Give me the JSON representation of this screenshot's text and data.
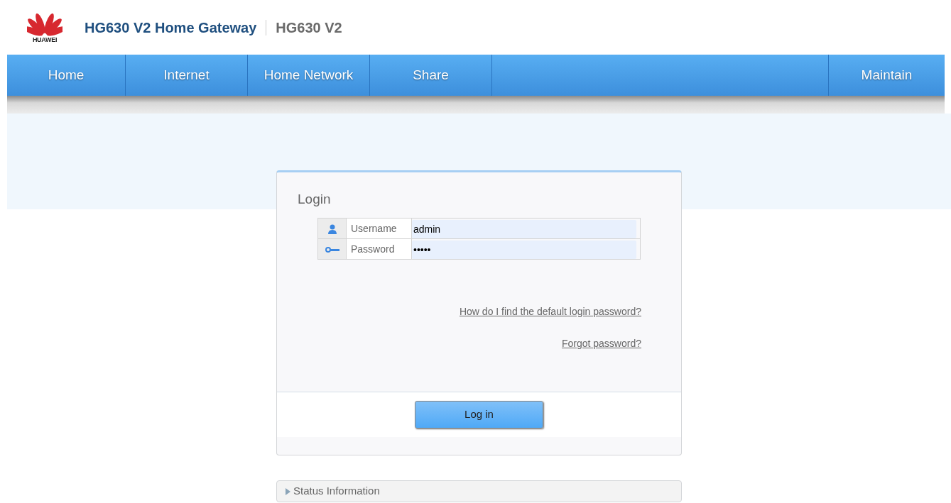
{
  "header": {
    "logo_text": "HUAWEI",
    "title": "HG630 V2 Home Gateway",
    "model": "HG630 V2"
  },
  "nav": {
    "items": [
      {
        "label": "Home"
      },
      {
        "label": "Internet"
      },
      {
        "label": "Home Network"
      },
      {
        "label": "Share"
      }
    ],
    "right_items": [
      {
        "label": "Maintain"
      }
    ]
  },
  "login": {
    "title": "Login",
    "fields": [
      {
        "kind": "user",
        "label": "Username",
        "value": "admin"
      },
      {
        "kind": "key",
        "label": "Password",
        "value": "•••••"
      }
    ],
    "links": [
      "How do I find the default login password?",
      "Forgot password?"
    ],
    "button": "Log in"
  },
  "status_panel": {
    "label": "Status Information",
    "expanded": false
  }
}
